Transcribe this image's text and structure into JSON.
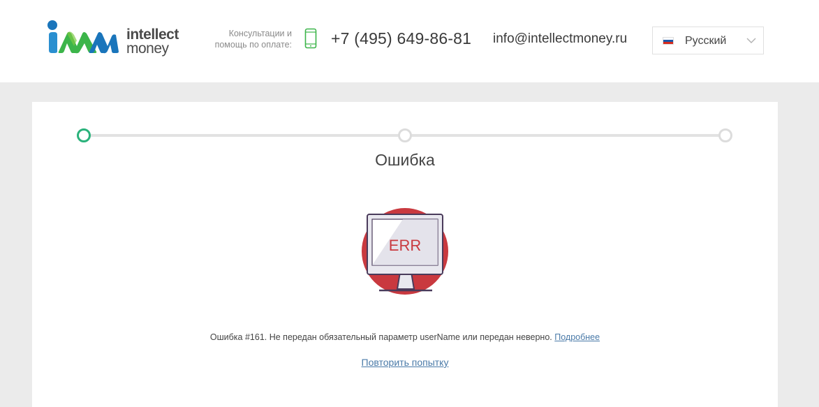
{
  "brand": {
    "word1": "intellect",
    "word2": "money",
    "colors": {
      "blue": "#1a75bb",
      "green": "#3cb54a",
      "text": "#4a4a4a"
    }
  },
  "header": {
    "consult_line1": "Консультации и",
    "consult_line2": "помощь по оплате:",
    "phone": "+7 (495) 649-86-81",
    "email": "info@intellectmoney.ru",
    "language": {
      "selected": "Русский",
      "flag": "russia-flag-icon"
    }
  },
  "progress": {
    "steps": 3,
    "active_step": 1,
    "accent": "#2ab27b"
  },
  "main": {
    "title": "Ошибка",
    "illustration": {
      "screen_text": "ERR",
      "accent": "#c9393f"
    },
    "message": "Ошибка #161. Не передан обязательный параметр userName или передан неверно.",
    "details_link": "Подробнее",
    "retry_link": "Повторить попытку"
  }
}
